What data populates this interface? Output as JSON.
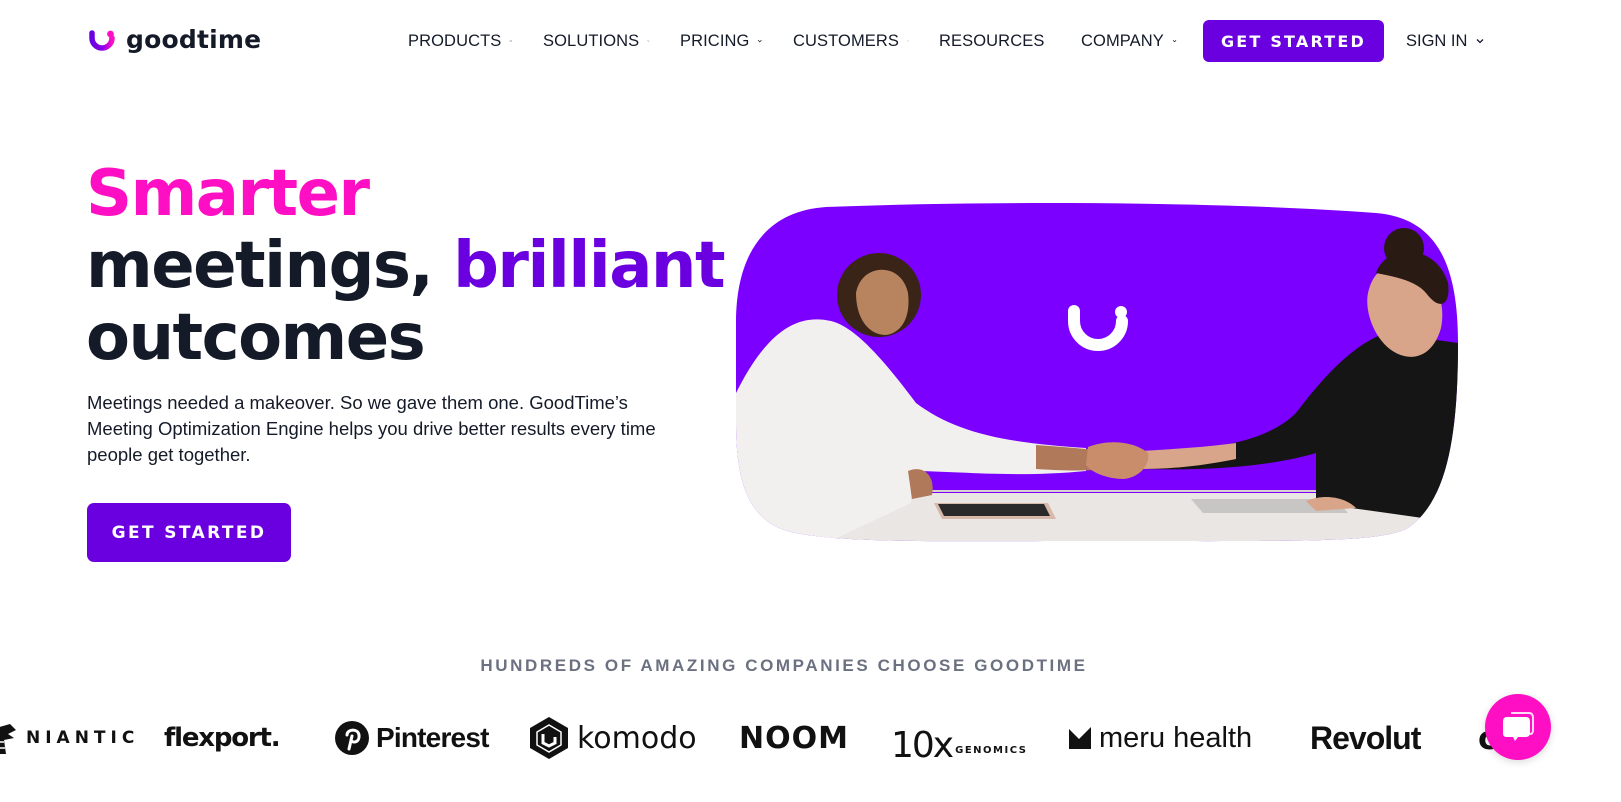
{
  "brand": {
    "name": "goodtime",
    "colors": {
      "primary": "#6a00e0",
      "accent_pink": "#ff0fc4",
      "text_dark": "#141a28",
      "hero_bg": "#7b00ff",
      "muted": "#6b7180"
    }
  },
  "nav": {
    "items": [
      {
        "label": "PRODUCTS",
        "icon": "chevron-down-icon"
      },
      {
        "label": "SOLUTIONS",
        "icon": "chevron-down-icon"
      },
      {
        "label": "PRICING",
        "icon": "chevron-down-icon"
      },
      {
        "label": "CUSTOMERS",
        "icon": "chevron-down-icon"
      },
      {
        "label": "RESOURCES",
        "icon": "chevron-down-icon"
      },
      {
        "label": "COMPANY",
        "icon": "chevron-down-icon"
      }
    ],
    "cta_label": "GET STARTED",
    "signin_label": "SIGN IN"
  },
  "hero": {
    "headline_line1": "Smarter",
    "headline_line2_a": "meetings, ",
    "headline_line2_b": "brilliant",
    "headline_line3": "outcomes",
    "lead": "Meetings needed a makeover. So we gave them one. GoodTime’s Meeting Optimization Engine helps you drive better results every time people get together.",
    "cta_label": "GET STARTED",
    "image_alt": "Two people shaking hands across a table on a purple background with the GoodTime logo"
  },
  "customers": {
    "title": "HUNDREDS OF AMAZING COMPANIES CHOOSE GOODTIME",
    "logos": [
      {
        "name": "NIANTIC"
      },
      {
        "name": "flexport."
      },
      {
        "name": "Pinterest"
      },
      {
        "name": "komodo"
      },
      {
        "name": "NOOM"
      },
      {
        "name": "10x",
        "sub": "GENOMICS"
      },
      {
        "name": "meru health"
      },
      {
        "name": "Revolut"
      },
      {
        "name": "ca"
      }
    ]
  },
  "chat": {
    "icon": "chat-bubbles-icon"
  }
}
